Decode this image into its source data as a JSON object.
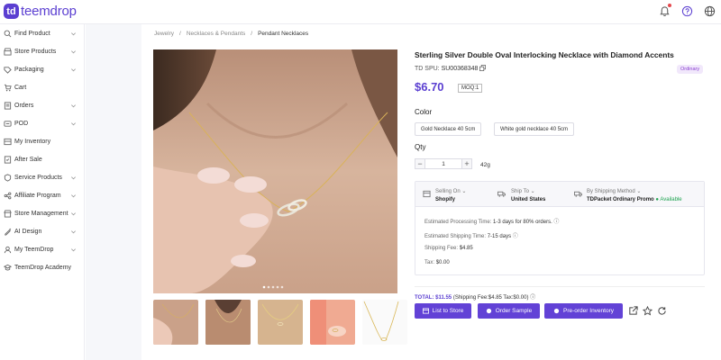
{
  "brand": {
    "mark": "td",
    "name": "teemdrop"
  },
  "top_icons": [
    "bell-icon",
    "help-icon",
    "globe-icon"
  ],
  "sidebar": {
    "items": [
      {
        "label": "Find Product",
        "icon": "search-icon",
        "chevron": true
      },
      {
        "label": "Store Products",
        "icon": "store-icon",
        "chevron": true
      },
      {
        "label": "Packaging",
        "icon": "package-icon",
        "chevron": true
      },
      {
        "label": "Cart",
        "icon": "cart-icon",
        "chevron": false
      },
      {
        "label": "Orders",
        "icon": "orders-icon",
        "chevron": true
      },
      {
        "label": "POD",
        "icon": "pod-icon",
        "chevron": true
      },
      {
        "label": "My Inventory",
        "icon": "inventory-icon",
        "chevron": false
      },
      {
        "label": "After Sale",
        "icon": "after-sale-icon",
        "chevron": false
      },
      {
        "label": "Service Products",
        "icon": "service-icon",
        "chevron": true
      },
      {
        "label": "Affiliate Program",
        "icon": "affiliate-icon",
        "chevron": true
      },
      {
        "label": "Store Management",
        "icon": "store-management-icon",
        "chevron": true
      },
      {
        "label": "AI Design",
        "icon": "ai-design-icon",
        "chevron": true
      },
      {
        "label": "My TeemDrop",
        "icon": "user-icon",
        "chevron": true
      },
      {
        "label": "TeemDrop Academy",
        "icon": "academy-icon",
        "chevron": false
      }
    ]
  },
  "breadcrumb": {
    "items": [
      "Jewelry",
      "Necklaces & Pendants",
      "Pendant Necklaces"
    ],
    "separator": "/"
  },
  "product": {
    "title": "Sterling Silver Double Oval Interlocking Necklace with Diamond Accents",
    "spu_label": "TD SPU:",
    "spu": "SU00368348",
    "badge": "Ordinary",
    "price": "$6.70",
    "moq": "MOQ:1",
    "color_label": "Color",
    "colors": [
      "Gold Necklace 40 5cm",
      "White gold necklace 40 5cm"
    ],
    "qty_label": "Qty",
    "qty_value": "1",
    "weight": "42g"
  },
  "shipping": {
    "selling_on_label": "Selling On",
    "selling_on": "Shopify",
    "ship_to_label": "Ship To",
    "ship_to": "United States",
    "method_label": "By Shipping Method",
    "method": "TDPacket Ordinary Promo",
    "method_status": "Available",
    "processing_label": "Estimated Processing Time:",
    "processing": "1-3 days for 80% orders.",
    "shipping_time_label": "Estimated Shipping Time:",
    "shipping_time": "7-15 days",
    "fee_label": "Shipping Fee:",
    "fee": "$4.85",
    "tax_label": "Tax:",
    "tax": "$0.00"
  },
  "totals": {
    "total_label": "TOTAL:",
    "total": "$11.55",
    "detail": "(Shipping Fee:$4.85   Tax:$0.00)"
  },
  "actions": {
    "list_to_store": "List to Store",
    "order_sample": "Order Sample",
    "preorder": "Pre-order Inventory"
  },
  "colors": {
    "brand": "#5b3fd1",
    "button": "#6242d6",
    "available": "#1da350",
    "badge_bg": "#f1e8fb",
    "badge_text": "#8a3fd1"
  }
}
